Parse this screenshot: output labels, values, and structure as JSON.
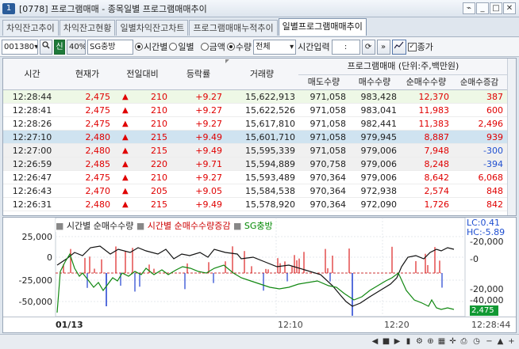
{
  "window": {
    "badge": "1",
    "title": "[0778] 프로그램매매 - 종목일별 프로그램매매추이"
  },
  "tabs": [
    "차익잔고추이",
    "차익잔고현황",
    "일별차익잔고차트",
    "프로그램매매누적추이",
    "일별프로그램매매추이"
  ],
  "toolbar": {
    "code": "001380",
    "shin_label": "신",
    "ratio": "40%",
    "stock_name": "SG충방",
    "view_options": [
      "시간별",
      "일별"
    ],
    "view_selected": "시간별",
    "unit_options": [
      "금액",
      "수량"
    ],
    "unit_selected": "수량",
    "filter": "전체",
    "time_input_label": "시간입력",
    "time_value": ":",
    "end_label": "종가",
    "end_checked": true
  },
  "table": {
    "group_header": "프로그램매매 (단위:주,백만원)",
    "columns": [
      "시간",
      "현재가",
      "전일대비",
      "등락률",
      "거래량",
      "매도수량",
      "매수수량",
      "순매수수량",
      "순매수증감"
    ],
    "rows": [
      {
        "time": "12:28:44",
        "price": "2,475",
        "change": "210",
        "rate": "+9.27",
        "volume": "15,622,913",
        "sell": "971,058",
        "buy": "983,428",
        "net": "12,370",
        "delta": "387",
        "delta_sign": "+"
      },
      {
        "time": "12:28:41",
        "price": "2,475",
        "change": "210",
        "rate": "+9.27",
        "volume": "15,622,526",
        "sell": "971,058",
        "buy": "983,041",
        "net": "11,983",
        "delta": "600",
        "delta_sign": "+"
      },
      {
        "time": "12:28:26",
        "price": "2,475",
        "change": "210",
        "rate": "+9.27",
        "volume": "15,617,810",
        "sell": "971,058",
        "buy": "982,441",
        "net": "11,383",
        "delta": "2,496",
        "delta_sign": "+"
      },
      {
        "time": "12:27:10",
        "price": "2,480",
        "change": "215",
        "rate": "+9.49",
        "volume": "15,601,710",
        "sell": "971,058",
        "buy": "979,945",
        "net": "8,887",
        "delta": "939",
        "delta_sign": "+"
      },
      {
        "time": "12:27:00",
        "price": "2,480",
        "change": "215",
        "rate": "+9.49",
        "volume": "15,595,339",
        "sell": "971,058",
        "buy": "979,006",
        "net": "7,948",
        "delta": "-300",
        "delta_sign": "-"
      },
      {
        "time": "12:26:59",
        "price": "2,485",
        "change": "220",
        "rate": "+9.71",
        "volume": "15,594,889",
        "sell": "970,758",
        "buy": "979,006",
        "net": "8,248",
        "delta": "-394",
        "delta_sign": "-"
      },
      {
        "time": "12:26:47",
        "price": "2,475",
        "change": "210",
        "rate": "+9.27",
        "volume": "15,593,489",
        "sell": "970,364",
        "buy": "979,006",
        "net": "8,642",
        "delta": "6,068",
        "delta_sign": "+"
      },
      {
        "time": "12:26:43",
        "price": "2,470",
        "change": "205",
        "rate": "+9.05",
        "volume": "15,584,538",
        "sell": "970,364",
        "buy": "972,938",
        "net": "2,574",
        "delta": "848",
        "delta_sign": "+"
      },
      {
        "time": "12:26:31",
        "price": "2,480",
        "change": "215",
        "rate": "+9.49",
        "volume": "15,578,920",
        "sell": "970,364",
        "buy": "972,090",
        "net": "1,726",
        "delta": "842",
        "delta_sign": "+"
      }
    ]
  },
  "chart": {
    "legend": [
      "시간별 순매수수량",
      "시간별 순매수수량증감",
      "SG충방"
    ],
    "legend_colors": [
      "#000000",
      "#cc0000",
      "#008800"
    ],
    "left_ticks": [
      "25,000",
      "0",
      "-25,000",
      "-50,000"
    ],
    "right_ticks": [
      "-20,000",
      "-0",
      "-20,000",
      "-40,000"
    ],
    "lc_label": "LC:0.41",
    "hc_label": "HC:-5.89",
    "price_tag": "2,475",
    "date_label": "01/13",
    "time_labels": [
      "12:10",
      "12:20",
      "12:28:44"
    ]
  },
  "colors": {
    "up": "#e00000",
    "down": "#1f4fd0",
    "selected_row": "#cfe3f0",
    "first_row": "#eef8e6"
  }
}
